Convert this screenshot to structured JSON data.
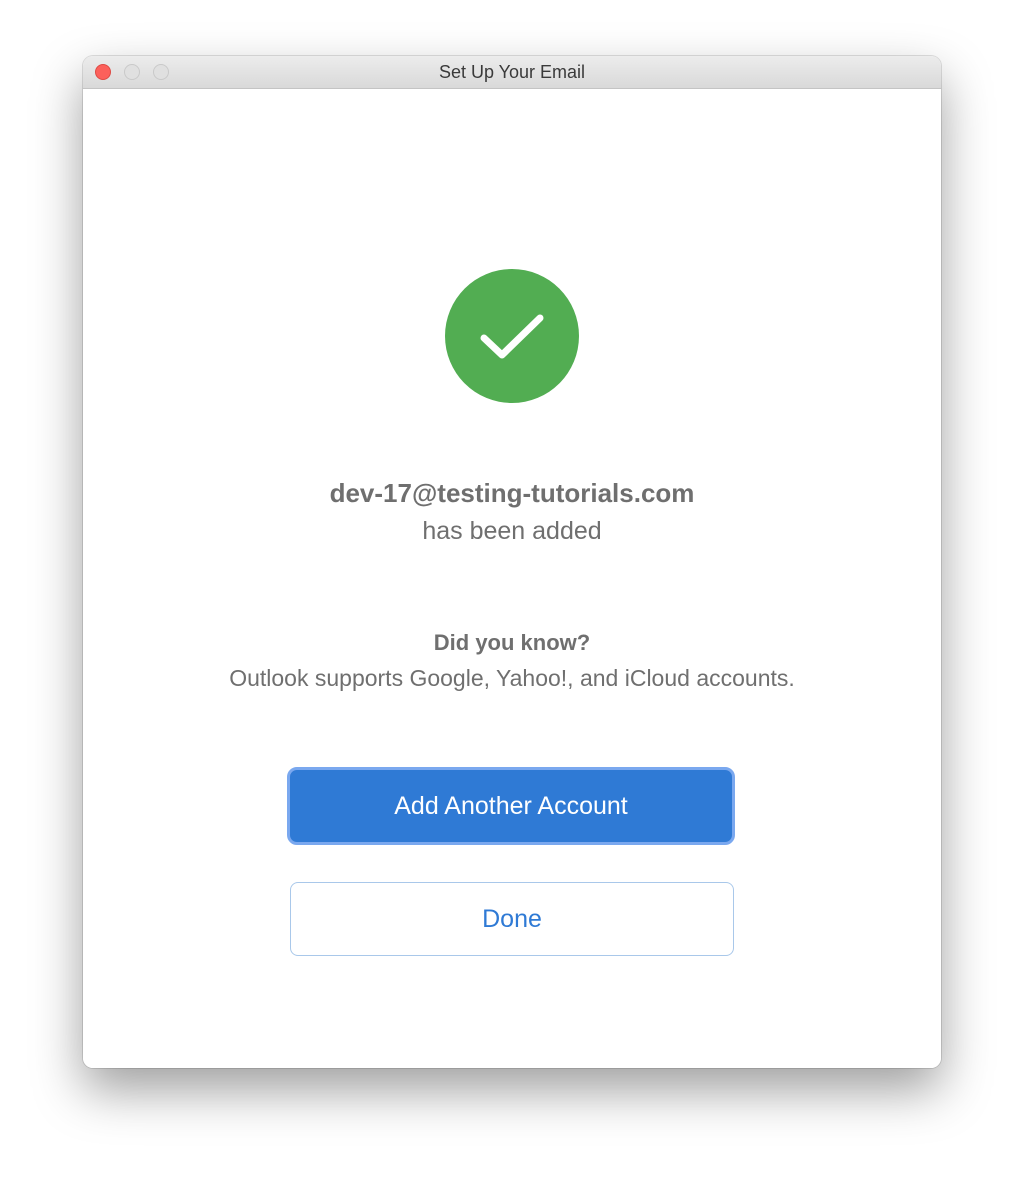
{
  "window": {
    "title": "Set Up Your Email"
  },
  "success": {
    "icon": "checkmark-icon",
    "color": "#52ad52",
    "email": "dev-17@testing-tutorials.com",
    "message": "has been added"
  },
  "tip": {
    "title": "Did you know?",
    "text": "Outlook supports Google, Yahoo!, and iCloud accounts."
  },
  "buttons": {
    "add_account_label": "Add Another Account",
    "done_label": "Done",
    "accent_color": "#2f7ad5"
  }
}
